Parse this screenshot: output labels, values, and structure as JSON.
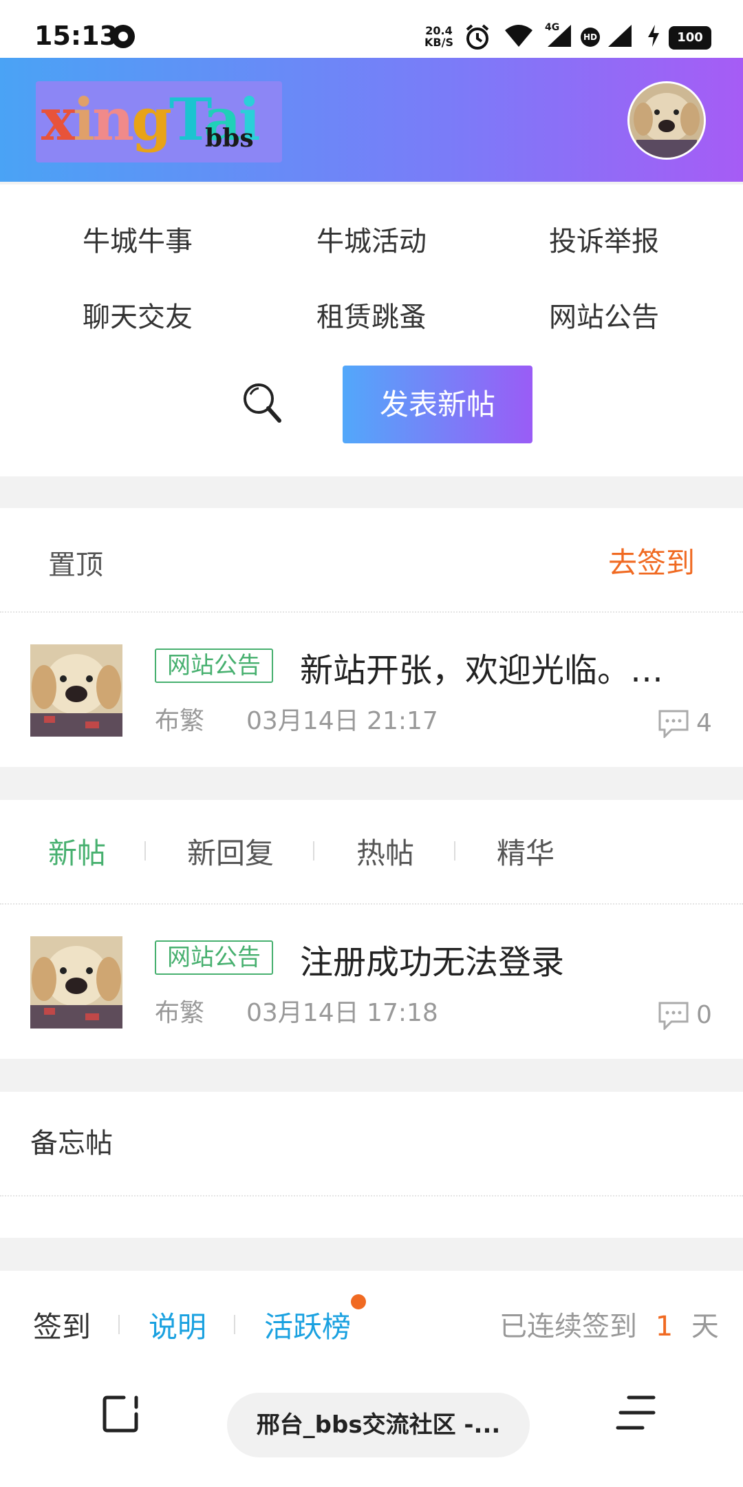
{
  "status_bar": {
    "time": "15:13",
    "net_speed_value": "20.4",
    "net_speed_unit": "KB/S",
    "network_label": "4G",
    "hd_label": "HD",
    "battery": "100"
  },
  "header": {
    "logo_main": "xingTai",
    "logo_sub": "bbs"
  },
  "nav": {
    "items": [
      "牛城牛事",
      "牛城活动",
      "投诉举报",
      "聊天交友",
      "租赁跳蚤",
      "网站公告"
    ],
    "post_button": "发表新帖"
  },
  "pinned": {
    "title": "置顶",
    "checkin_link": "去签到",
    "post": {
      "tag": "网站公告",
      "title": "新站开张，欢迎光临。大...",
      "author": "布繁",
      "date": "03月14日 21:17",
      "comments": "4"
    }
  },
  "list": {
    "tabs": [
      "新帖",
      "新回复",
      "热帖",
      "精华"
    ],
    "active_tab": "新帖",
    "post": {
      "tag": "网站公告",
      "title": "注册成功无法登录",
      "author": "布繁",
      "date": "03月14日 17:18",
      "comments": "0"
    }
  },
  "memo": {
    "title": "备忘帖"
  },
  "checkin": {
    "label": "签到",
    "explain": "说明",
    "rank": "活跃榜",
    "streak_prefix": "已连续签到",
    "streak_days": "1",
    "streak_suffix": "天"
  },
  "bottom": {
    "url_title": "邢台_bbs交流社区 -..."
  },
  "colors": {
    "accent_green": "#47b06f",
    "accent_orange": "#f06a22",
    "accent_blue": "#1aa1e0",
    "header_gradient": [
      "#4aa3f5",
      "#a65cf5"
    ]
  }
}
